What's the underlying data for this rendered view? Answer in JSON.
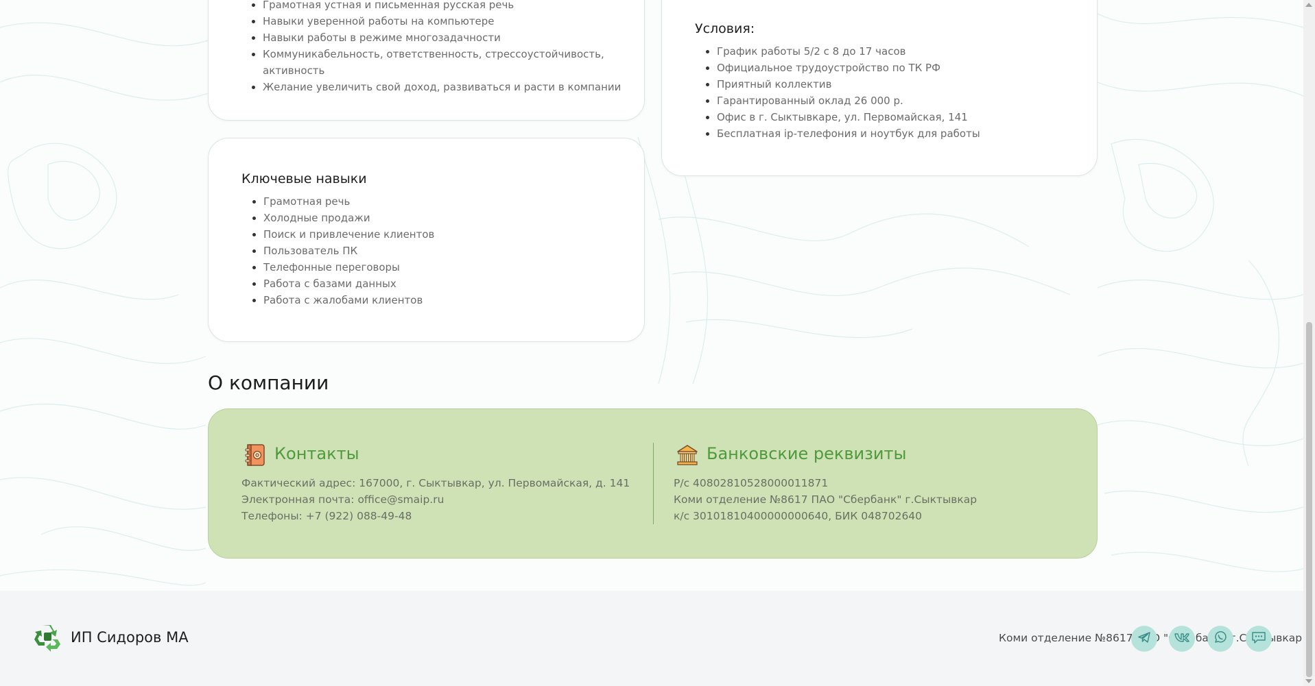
{
  "requirements_card": {
    "partial_item": "Грамотная устная и письменная русская речь",
    "items": [
      "Навыки уверенной работы на компьютере",
      "Навыки работы в режиме многозадачности",
      "Коммуникабельность, ответственность, стрессоустойчивость, активность",
      "Желание увеличить свой доход, развиваться и расти в компании"
    ]
  },
  "conditions_card": {
    "title": "Условия:",
    "items": [
      "График работы 5/2 с 8 до 17 часов",
      "Официальное трудоустройство по ТК РФ",
      "Приятный коллектив",
      "Гарантированный оклад 26 000 р.",
      "Офис в г. Сыктывкаре, ул. Первомайская, 141",
      "Бесплатная ip-телефония и ноутбук для работы"
    ]
  },
  "skills_card": {
    "title": "Ключевые навыки",
    "items": [
      "Грамотная речь",
      "Холодные продажи",
      "Поиск и привлечение клиентов",
      "Пользователь ПК",
      "Телефонные переговоры",
      "Работа с базами данных",
      "Работа с жалобами клиентов"
    ]
  },
  "about": {
    "title": "О компании",
    "contacts": {
      "title": "Контакты",
      "icon": "address-book-icon",
      "lines": [
        "Фактический адрес: 167000, г. Сыктывкар, ул. Первомайская, д. 141",
        "Электронная почта: office@smaip.ru",
        "Телефоны: +7 (922) 088-49-48"
      ]
    },
    "bank": {
      "title": "Банковские реквизиты",
      "icon": "bank-icon",
      "lines": [
        "Р/с 40802810528000011871",
        "Коми отделение №8617 ПАО \"Сбербанк\" г.Сыктывкар",
        "к/с 30101810400000000640, БИК 048702640"
      ]
    }
  },
  "footer": {
    "brand": "ИП Сидоров МА",
    "text": "Коми отделение №8617 ПАО \"Сбербанк\" г.Сыктывкар",
    "social": [
      "telegram-icon",
      "vk-icon",
      "whatsapp-icon",
      "chat-icon"
    ]
  },
  "colors": {
    "accent_green": "#4f9a3c",
    "panel_green": "#cfe2b6",
    "social_button": "#b5e3dc"
  }
}
